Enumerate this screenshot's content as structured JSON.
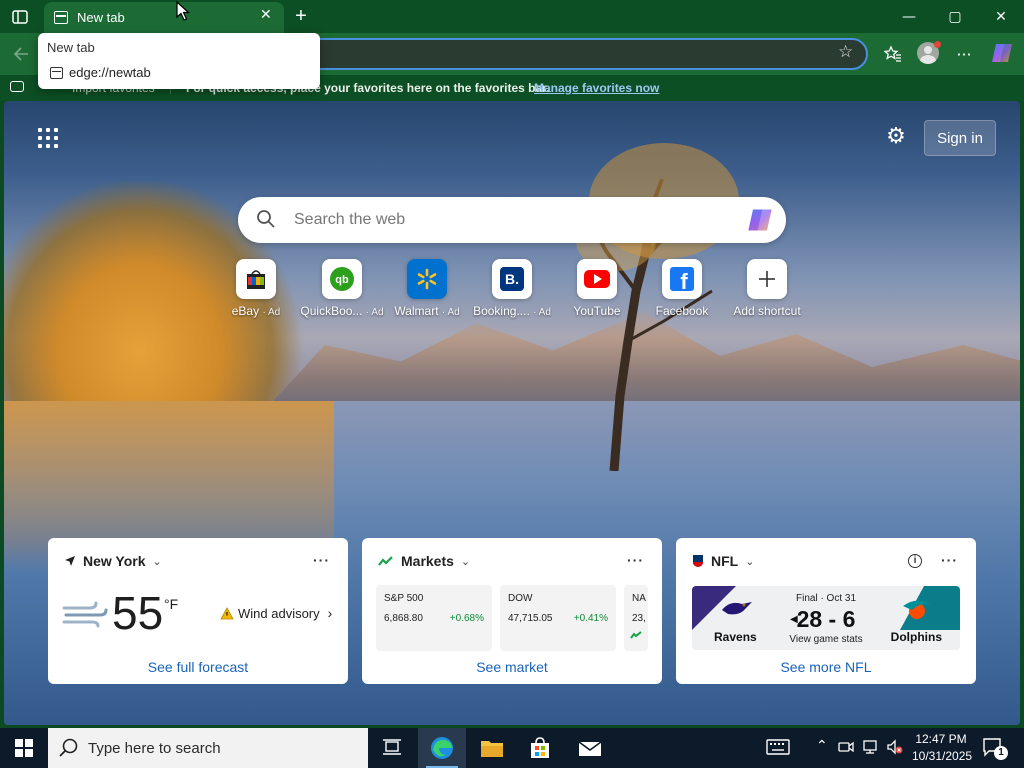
{
  "browser": {
    "tab_title": "New tab",
    "tab_close_icon": "close-icon",
    "new_tab_icon": "plus-icon",
    "window_controls": {
      "minimize": "—",
      "maximize": "▢",
      "close": "✕"
    },
    "favorites_bar": {
      "import_label": "Import favorites",
      "message": "For quick access, place your favorites here on the favorites bar.",
      "manage_link": "Manage favorites now"
    },
    "dropdown": {
      "header": "New tab",
      "url": "edge://newtab"
    },
    "accent_color": "#4a8fe0"
  },
  "newtab": {
    "signin_label": "Sign in",
    "search_placeholder": "Search the web",
    "shortcuts": [
      {
        "label": "eBay",
        "ad": "· Ad",
        "icon": "ebay-icon"
      },
      {
        "label": "QuickBoo...",
        "ad": "· Ad",
        "icon": "quickbooks-icon"
      },
      {
        "label": "Walmart",
        "ad": "· Ad",
        "icon": "walmart-icon"
      },
      {
        "label": "Booking....",
        "ad": "· Ad",
        "icon": "booking-icon"
      },
      {
        "label": "YouTube",
        "ad": "",
        "icon": "youtube-icon"
      },
      {
        "label": "Facebook",
        "ad": "",
        "icon": "facebook-icon"
      },
      {
        "label": "Add shortcut",
        "ad": "",
        "icon": "plus-icon"
      }
    ]
  },
  "weather": {
    "location": "New York",
    "temp": "55",
    "unit": "°F",
    "advisory": "Wind advisory",
    "link": "See full forecast",
    "more": "···"
  },
  "markets": {
    "title": "Markets",
    "stocks": [
      {
        "name": "S&P 500",
        "value": "6,868.80",
        "change": "+0.68%"
      },
      {
        "name": "DOW",
        "value": "47,715.05",
        "change": "+0.41%"
      },
      {
        "name": "NA",
        "value": "23,",
        "change": ""
      }
    ],
    "link": "See market",
    "more": "···"
  },
  "nfl": {
    "title": "NFL",
    "status": "Final · Oct 31",
    "score": "28 - 6",
    "stats_link": "View game stats",
    "home": "Ravens",
    "away": "Dolphins",
    "link": "See more NFL",
    "more": "···"
  },
  "taskbar": {
    "search_placeholder": "Type here to search",
    "time": "12:47 PM",
    "date": "10/31/2025",
    "notification_count": "1"
  }
}
